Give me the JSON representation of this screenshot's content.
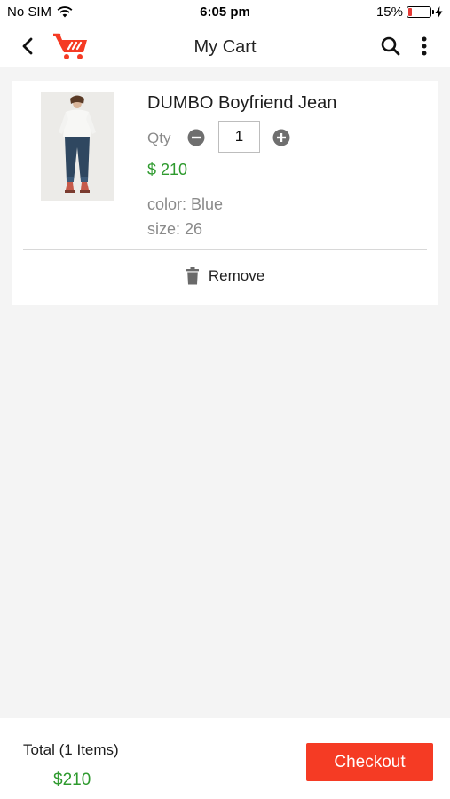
{
  "status_bar": {
    "carrier": "No SIM",
    "time": "6:05 pm",
    "battery_percent": "15%",
    "battery_level": 0.15,
    "battery_color": "#e53935"
  },
  "header": {
    "title": "My Cart",
    "icons": [
      "chevron-left-icon",
      "cart-logo-icon",
      "search-icon",
      "more-vertical-icon"
    ],
    "brand_color": "#f53b24"
  },
  "cart": {
    "items": [
      {
        "name": "DUMBO Boyfriend Jean",
        "qty_label": "Qty",
        "qty": "1",
        "price": "$ 210",
        "color_text": "color: Blue",
        "size_text": "size: 26",
        "remove_label": "Remove"
      }
    ]
  },
  "footer": {
    "total_label": "Total (1 Items)",
    "total_amount": "$210",
    "checkout_label": "Checkout"
  },
  "colors": {
    "price_green": "#2e9a2e",
    "checkout_bg": "#f53b24",
    "background": "#f4f4f4"
  }
}
